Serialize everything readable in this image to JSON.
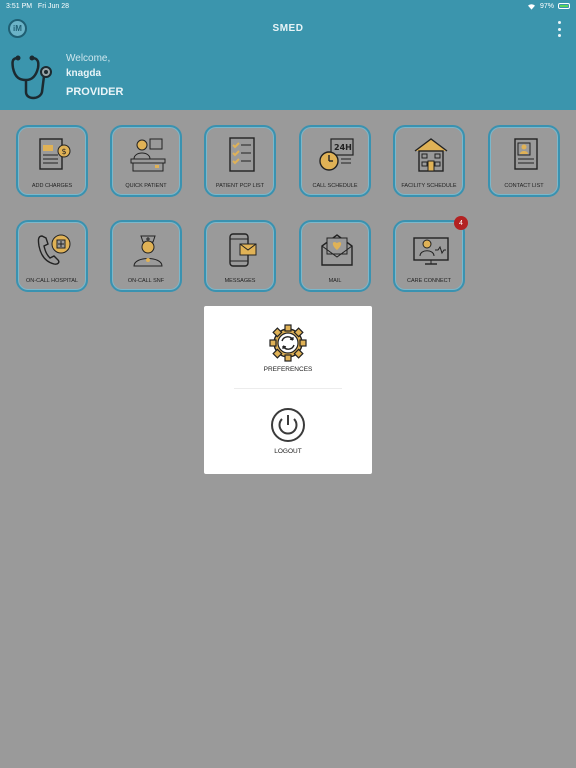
{
  "status_bar": {
    "time": "3:51 PM",
    "date": "Fri Jun 28",
    "battery": "97%"
  },
  "app": {
    "title": "SMED",
    "logo_text": "iM"
  },
  "header": {
    "welcome": "Welcome,",
    "username": "knagda",
    "role": "PROVIDER"
  },
  "tiles": [
    {
      "label": "ADD CHARGES",
      "icon": "invoice-icon"
    },
    {
      "label": "QUICK PATIENT",
      "icon": "doctor-desk-icon"
    },
    {
      "label": "PATIENT PCP LIST",
      "icon": "checklist-icon"
    },
    {
      "label": "CALL SCHEDULE",
      "icon": "24h-clock-icon"
    },
    {
      "label": "FACILITY SCHEDULE",
      "icon": "facility-building-icon"
    },
    {
      "label": "CONTACT LIST",
      "icon": "contact-card-icon"
    },
    {
      "label": "ON-CALL HOSPITAL",
      "icon": "phone-hospital-icon"
    },
    {
      "label": "ON-CALL SNF",
      "icon": "nurse-icon"
    },
    {
      "label": "MESSAGES",
      "icon": "mobile-message-icon"
    },
    {
      "label": "MAIL",
      "icon": "mail-heart-icon"
    },
    {
      "label": "CARE CONNECT",
      "icon": "doctor-monitor-icon",
      "badge": "4"
    }
  ],
  "popup": {
    "preferences_label": "PREFERENCES",
    "logout_label": "LOGOUT"
  },
  "colors": {
    "header": "#3b95ad",
    "overlay": "#9a9a9a",
    "accent_gold": "#e0b256",
    "badge": "#b32222"
  }
}
